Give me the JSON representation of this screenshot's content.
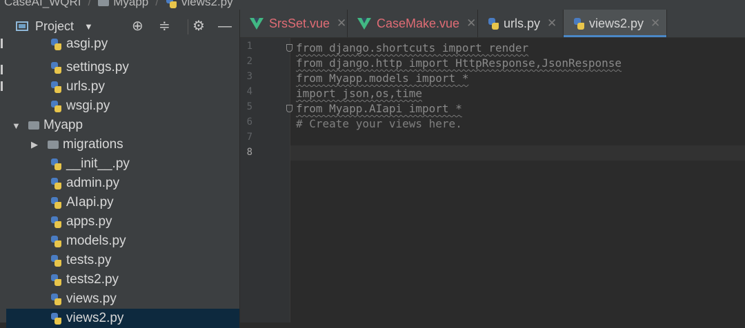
{
  "breadcrumb": [
    "CaseAI_WQRI",
    "Myapp",
    "views2.py"
  ],
  "project_panel": {
    "title": "Project",
    "tree": [
      {
        "label": "asgi.py",
        "type": "py",
        "level": 2
      },
      {
        "label": "settings.py",
        "type": "py",
        "level": 2
      },
      {
        "label": "urls.py",
        "type": "py",
        "level": 2
      },
      {
        "label": "wsgi.py",
        "type": "py",
        "level": 2
      },
      {
        "label": "Myapp",
        "type": "folder-open",
        "level": 0
      },
      {
        "label": "migrations",
        "type": "folder-closed",
        "level": 1
      },
      {
        "label": "__init__.py",
        "type": "py",
        "level": 2
      },
      {
        "label": "admin.py",
        "type": "py",
        "level": 2
      },
      {
        "label": "AIapi.py",
        "type": "py",
        "level": 2
      },
      {
        "label": "apps.py",
        "type": "py",
        "level": 2
      },
      {
        "label": "models.py",
        "type": "py",
        "level": 2
      },
      {
        "label": "tests.py",
        "type": "py",
        "level": 2
      },
      {
        "label": "tests2.py",
        "type": "py",
        "level": 2
      },
      {
        "label": "views.py",
        "type": "py",
        "level": 2
      },
      {
        "label": "views2.py",
        "type": "py",
        "level": 2,
        "selected": true
      }
    ]
  },
  "tabs": [
    {
      "label": "SrsSet.vue",
      "type": "vue"
    },
    {
      "label": "CaseMake.vue",
      "type": "vue"
    },
    {
      "label": "urls.py",
      "type": "py"
    },
    {
      "label": "views2.py",
      "type": "py",
      "active": true
    }
  ],
  "editor": {
    "current_line": 8,
    "lines": [
      {
        "n": "1",
        "text": "from django.shortcuts import render",
        "style": "unused",
        "fold": true
      },
      {
        "n": "2",
        "text": "from django.http import HttpResponse,JsonResponse",
        "style": "unused"
      },
      {
        "n": "3",
        "text": "from Myapp.models import *",
        "style": "unused"
      },
      {
        "n": "4",
        "text": "import json,os,time",
        "style": "unused"
      },
      {
        "n": "5",
        "text": "from Myapp.AIapi import *",
        "style": "unused",
        "fold": true
      },
      {
        "n": "6",
        "text": "# Create your views here.",
        "style": "comment"
      },
      {
        "n": "7",
        "text": "",
        "style": "plain"
      },
      {
        "n": "8",
        "text": "",
        "style": "plain"
      }
    ]
  }
}
